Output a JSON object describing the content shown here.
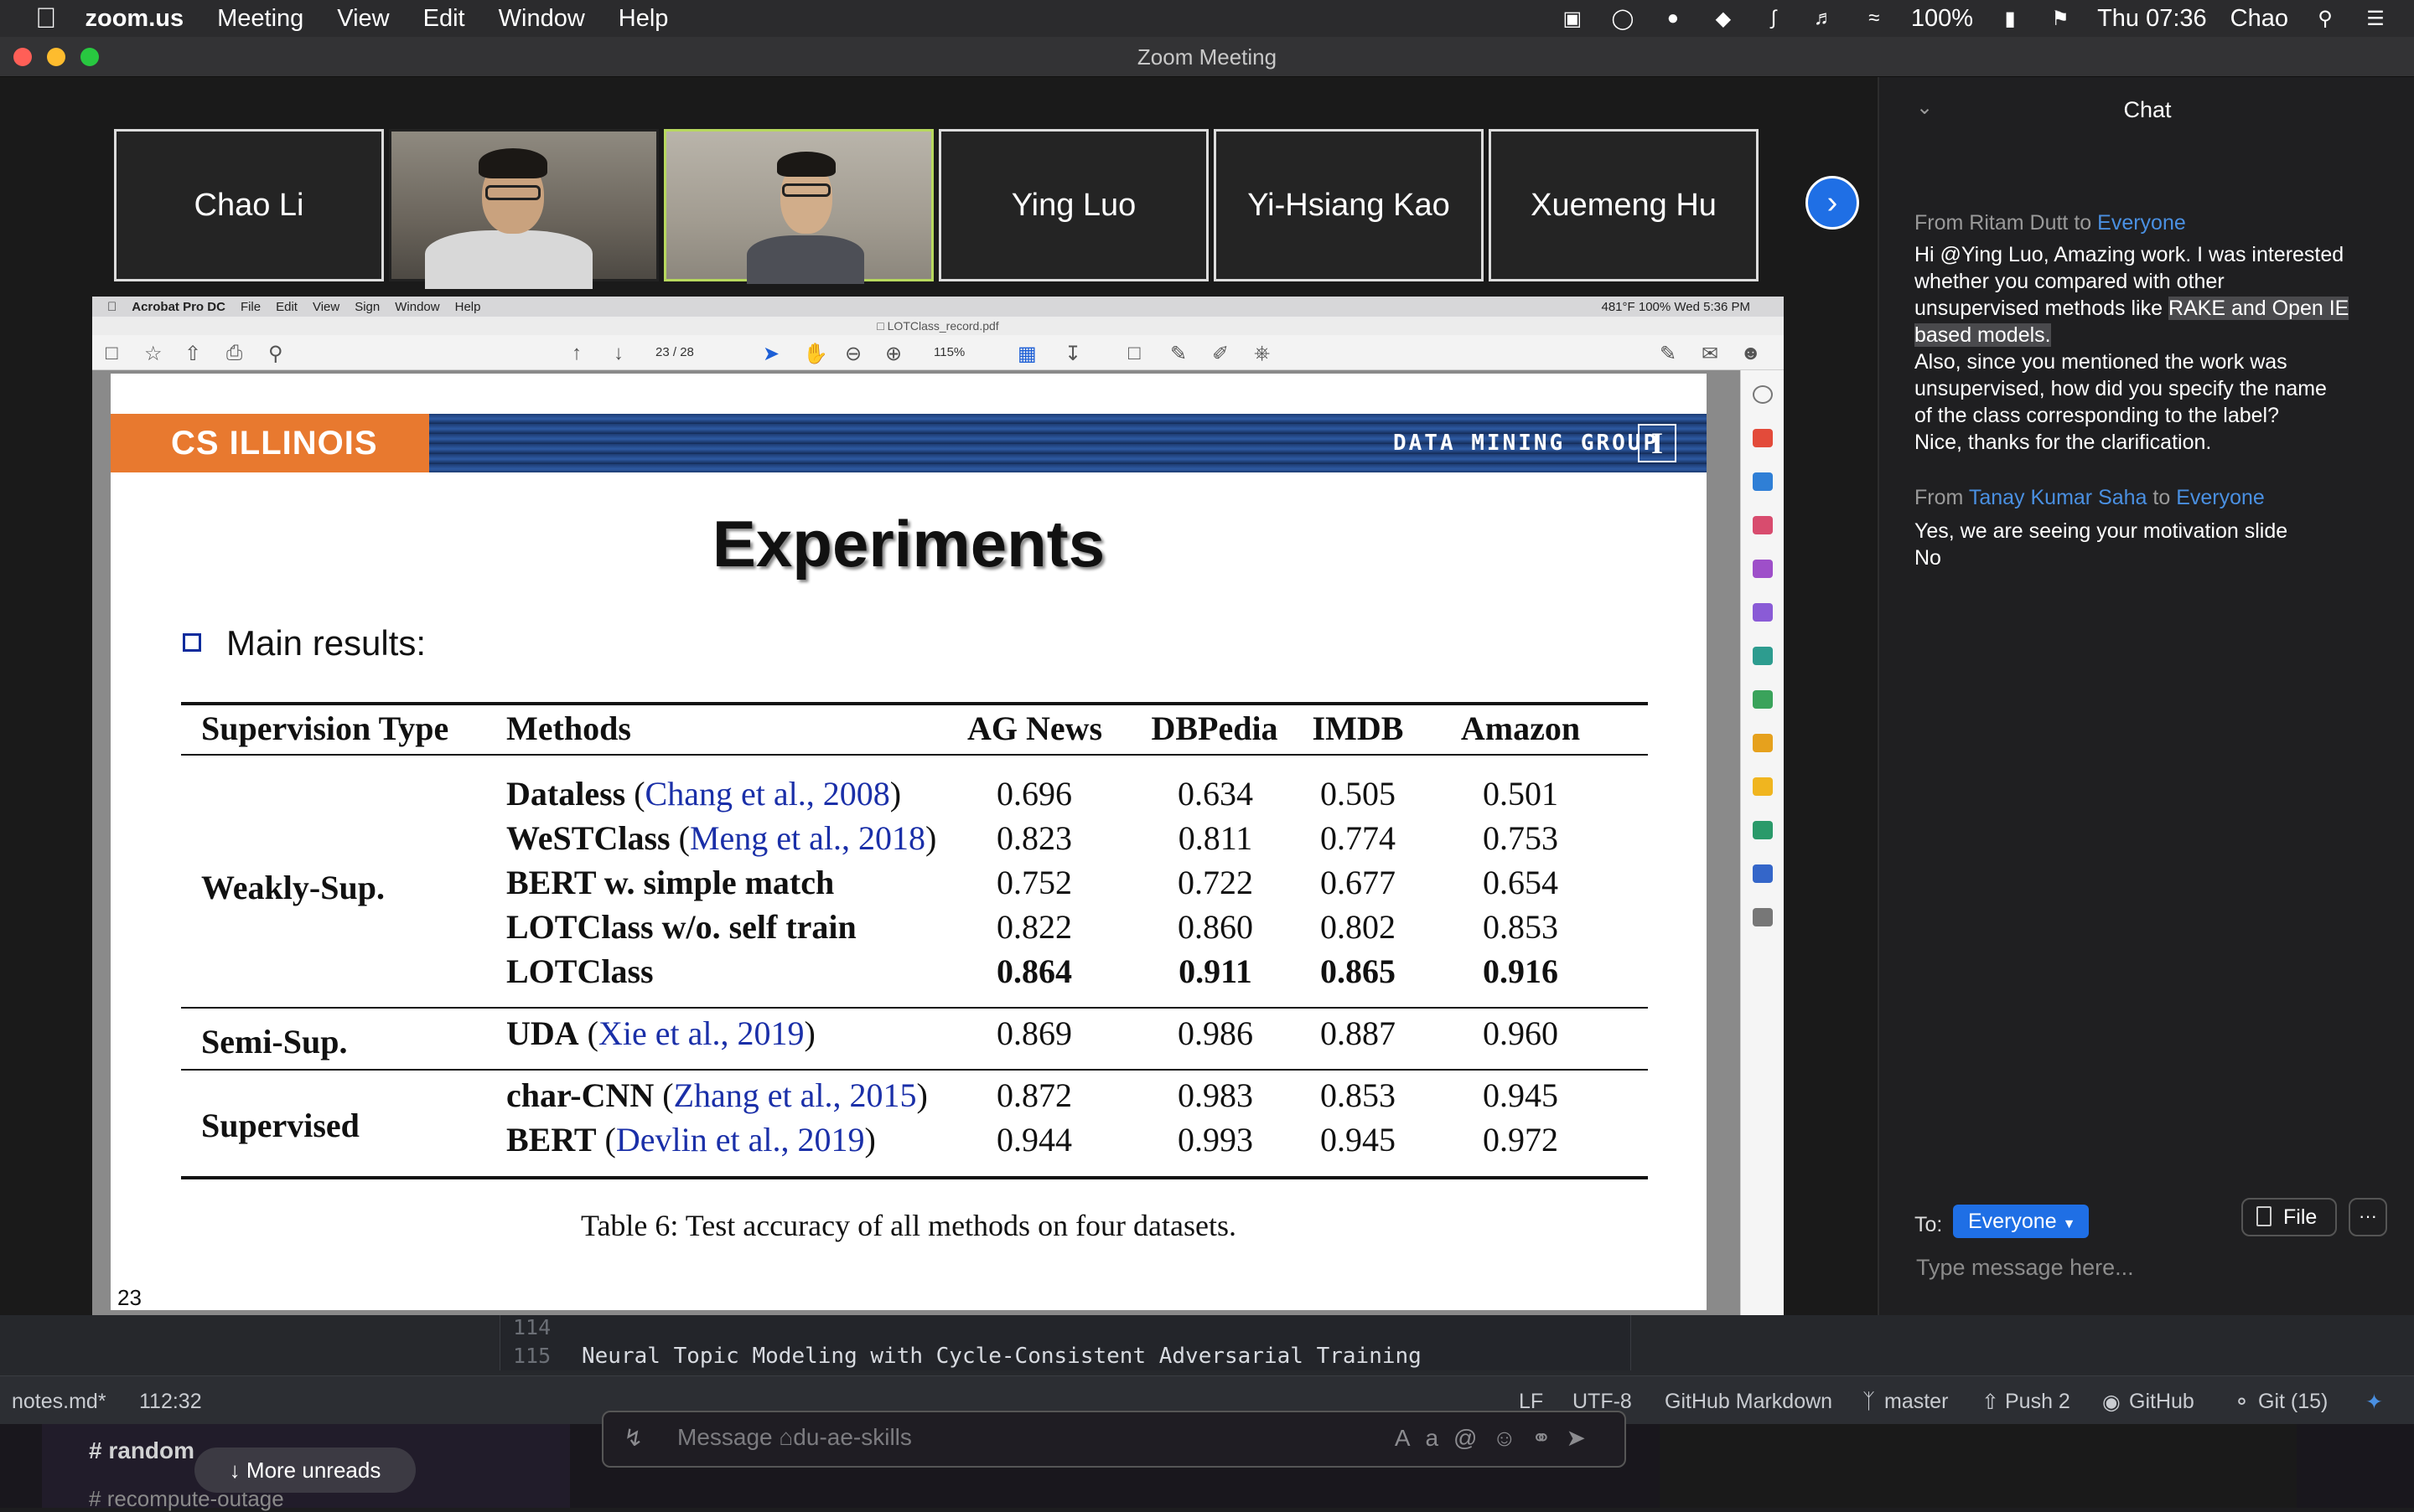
{
  "menubar": {
    "app_name": "zoom.us",
    "items": [
      "Meeting",
      "View",
      "Edit",
      "Window",
      "Help"
    ],
    "battery": "100%",
    "clock": "Thu 07:36",
    "user": "Chao"
  },
  "window": {
    "title": "Zoom Meeting"
  },
  "participants": [
    {
      "name": "Chao Li",
      "video": false,
      "active": false
    },
    {
      "name": "",
      "video": true,
      "active": false
    },
    {
      "name": "",
      "video": true,
      "active": true
    },
    {
      "name": "Ying Luo",
      "video": false,
      "active": false
    },
    {
      "name": "Yi-Hsiang Kao",
      "video": false,
      "active": false
    },
    {
      "name": "Xuemeng Hu",
      "video": false,
      "active": false
    }
  ],
  "acrobat": {
    "app_menu": [
      "Acrobat Pro DC",
      "File",
      "Edit",
      "View",
      "Sign",
      "Window",
      "Help"
    ],
    "status_right": "481°F   100%   Wed 5:36 PM",
    "filename": "LOTClass_record.pdf",
    "page_current": "23",
    "page_total": "/ 28",
    "zoom": "115%"
  },
  "slide": {
    "banner_left": "CS ILLINOIS",
    "banner_right": "DATA MINING GROUP",
    "logo_letter": "I",
    "title": "Experiments",
    "bullet": "Main results:",
    "table": {
      "headers": [
        "Supervision Type",
        "Methods",
        "AG News",
        "DBPedia",
        "IMDB",
        "Amazon"
      ],
      "groups": {
        "weak": "Weakly-Sup.",
        "semi": "Semi-Sup.",
        "sup": "Supervised"
      },
      "rows": [
        {
          "method": "Dataless",
          "cite": "Chang et al., 2008",
          "values": [
            "0.696",
            "0.634",
            "0.505",
            "0.501"
          ]
        },
        {
          "method": "WeSTClass",
          "cite": "Meng et al., 2018",
          "values": [
            "0.823",
            "0.811",
            "0.774",
            "0.753"
          ]
        },
        {
          "method": "BERT w. simple match",
          "cite": "",
          "values": [
            "0.752",
            "0.722",
            "0.677",
            "0.654"
          ]
        },
        {
          "method": "LOTClass w/o. self train",
          "cite": "",
          "values": [
            "0.822",
            "0.860",
            "0.802",
            "0.853"
          ]
        },
        {
          "method": "LOTClass",
          "cite": "",
          "values": [
            "0.864",
            "0.911",
            "0.865",
            "0.916"
          ]
        },
        {
          "method": "UDA",
          "cite": "Xie et al., 2019",
          "values": [
            "0.869",
            "0.986",
            "0.887",
            "0.960"
          ]
        },
        {
          "method": "char-CNN",
          "cite": "Zhang et al., 2015",
          "values": [
            "0.872",
            "0.983",
            "0.853",
            "0.945"
          ]
        },
        {
          "method": "BERT",
          "cite": "Devlin et al., 2019",
          "values": [
            "0.944",
            "0.993",
            "0.945",
            "0.972"
          ]
        }
      ]
    },
    "caption": "Table 6: Test accuracy of all methods on four datasets.",
    "page_number": "23"
  },
  "chat": {
    "title": "Chat",
    "messages": [
      {
        "from": "Ritam Dutt",
        "to": "Everyone",
        "lines": [
          "Hi @Ying Luo, Amazing work. I was interested",
          "whether you compared with other",
          "unsupervised methods like ",
          "RAKE and Open IE",
          "based models.",
          "Also, since you mentioned the work was",
          "unsupervised, how did you specify the name",
          "of the class corresponding to the label?",
          "Nice, thanks for the clarification."
        ]
      },
      {
        "from": "Tanay Kumar Saha",
        "to": "Everyone",
        "lines": [
          "Yes, we are seeing your motivation slide",
          "No"
        ]
      }
    ],
    "from_prefix": "From",
    "to_word": "to",
    "to_label": "To:",
    "recipient": "Everyone",
    "file_button": "File",
    "more_button": "···",
    "input_placeholder": "Type message here..."
  },
  "editor": {
    "line_114": "114",
    "line_115": "115",
    "code_115": "Neural Topic Modeling with Cycle-Consistent Adversarial Training",
    "status": {
      "file": "notes.md*",
      "cursor": "112:32",
      "eol": "LF",
      "encoding": "UTF-8",
      "grammar": "GitHub Markdown",
      "branch": "master",
      "push": "Push 2",
      "github": "GitHub",
      "git": "Git (15)"
    }
  },
  "slack": {
    "channel": "random",
    "channel_below": "recompute-outage",
    "more_unreads": "More unreads",
    "compose_placeholder": "Message ⌂du-ae-skills"
  },
  "colors": {
    "accent_blue": "#1f6fe5",
    "chat_name_blue": "#4a90e2",
    "illinois_orange": "#e8792f",
    "active_speaker": "#b7d85e"
  }
}
